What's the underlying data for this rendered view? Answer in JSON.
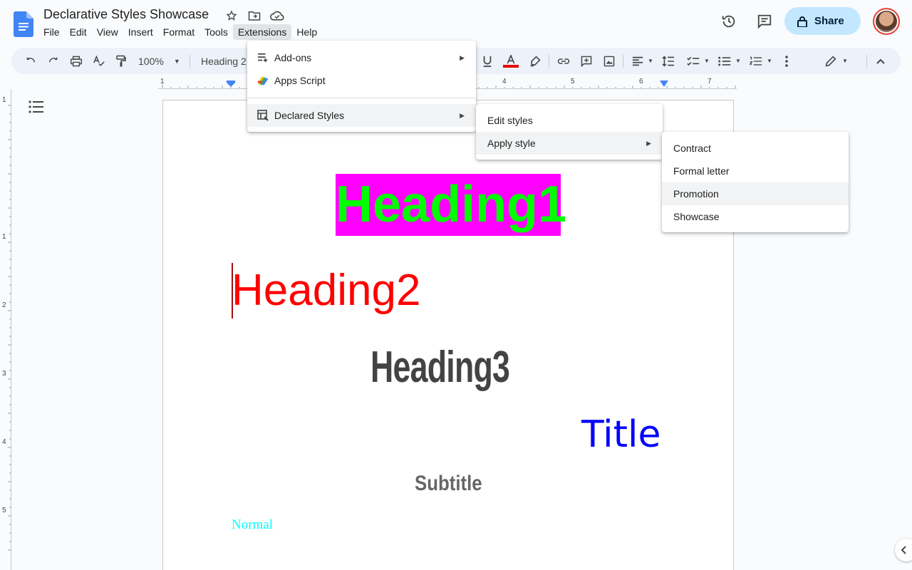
{
  "app": {
    "doc_title": "Declarative Styles Showcase",
    "menu": [
      "File",
      "Edit",
      "View",
      "Insert",
      "Format",
      "Tools",
      "Extensions",
      "Help"
    ],
    "share_label": "Share"
  },
  "toolbar": {
    "zoom": "100%",
    "style": "Heading 2"
  },
  "ruler": {
    "h_numbers": [
      "1",
      "4",
      "5",
      "6",
      "7"
    ],
    "v_numbers": [
      "1",
      "1",
      "2",
      "3",
      "4",
      "5"
    ]
  },
  "extensions_menu": {
    "items": [
      {
        "label": "Add-ons",
        "icon": "add-ons-icon",
        "has_submenu": true
      },
      {
        "label": "Apps Script",
        "icon": "apps-script-icon",
        "has_submenu": false
      },
      {
        "label": "Declared Styles",
        "icon": "declared-styles-icon",
        "has_submenu": true
      }
    ]
  },
  "declared_styles_menu": {
    "items": [
      {
        "label": "Edit styles",
        "has_submenu": false
      },
      {
        "label": "Apply style",
        "has_submenu": true
      }
    ]
  },
  "apply_style_menu": {
    "items": [
      "Contract",
      "Formal letter",
      "Promotion",
      "Showcase"
    ],
    "highlighted": "Promotion"
  },
  "document": {
    "heading1": "Heading1",
    "heading2": "Heading2",
    "heading3": "Heading3",
    "title": "Title",
    "subtitle": "Subtitle",
    "normal": "Normal"
  },
  "colors": {
    "heading1_text": "#00ff00",
    "heading1_bg": "#ff00ff",
    "heading2_text": "#ff0000",
    "heading3_text": "#434343",
    "title_text": "#0000ff",
    "subtitle_text": "#666666",
    "normal_text": "#00ffff",
    "share_bg": "#c2e7ff",
    "docs_blue": "#4285f4"
  }
}
